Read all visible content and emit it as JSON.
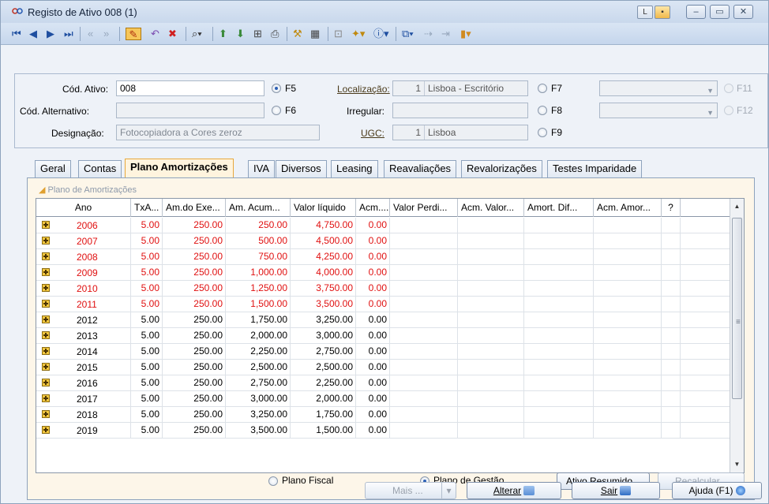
{
  "window": {
    "title": "Registo de Ativo 008 (1)"
  },
  "toolbar": {
    "icons": [
      "first-record-icon",
      "previous-record-icon",
      "next-record-icon",
      "last-record-icon",
      "page-back-icon",
      "page-forward-icon",
      "edit-icon",
      "undo-icon",
      "delete-icon",
      "search-icon",
      "import-icon",
      "export-icon",
      "tree-icon",
      "print-icon",
      "tools-icon",
      "calculator-icon",
      "zoom-icon",
      "paint-icon",
      "info-icon",
      "copy-icon",
      "link-icon",
      "unlink-icon",
      "bookmark-icon"
    ]
  },
  "header": {
    "cod_ativo_label": "Cód. Ativo:",
    "cod_ativo_value": "008",
    "cod_alt_label": "Cód. Alternativo:",
    "cod_alt_value": "",
    "designacao_label": "Designação:",
    "designacao_value": "Fotocopiadora a Cores zeroz",
    "localizacao_label": "Localização:",
    "localizacao_num": "1",
    "localizacao_value": "Lisboa - Escritório",
    "irregular_label": "Irregular:",
    "ugc_label": "UGC:",
    "ugc_num": "1",
    "ugc_value": "Lisboa",
    "radios": {
      "f5": "F5",
      "f6": "F6",
      "f7": "F7",
      "f8": "F8",
      "f9": "F9",
      "f11": "F11",
      "f12": "F12"
    }
  },
  "tabs": [
    "Geral",
    "Contas",
    "Plano Amortizações",
    "IVA",
    "Diversos",
    "Leasing",
    "Reavaliações",
    "Revalorizações",
    "Testes Imparidade"
  ],
  "grid": {
    "group_label": "Plano de Amortizações",
    "columns": [
      "Ano",
      "TxA...",
      "Am.do Exe...",
      "Am. Acum...",
      "Valor líquido",
      "Acm....",
      "Valor Perdi...",
      "Acm. Valor...",
      "Amort. Dif...",
      "Acm. Amor...",
      "?"
    ],
    "rows": [
      {
        "ano": "2006",
        "tx": "5.00",
        "am": "250.00",
        "acum": "250.00",
        "vl": "4,750.00",
        "acm": "0.00",
        "red": true
      },
      {
        "ano": "2007",
        "tx": "5.00",
        "am": "250.00",
        "acum": "500.00",
        "vl": "4,500.00",
        "acm": "0.00",
        "red": true
      },
      {
        "ano": "2008",
        "tx": "5.00",
        "am": "250.00",
        "acum": "750.00",
        "vl": "4,250.00",
        "acm": "0.00",
        "red": true
      },
      {
        "ano": "2009",
        "tx": "5.00",
        "am": "250.00",
        "acum": "1,000.00",
        "vl": "4,000.00",
        "acm": "0.00",
        "red": true
      },
      {
        "ano": "2010",
        "tx": "5.00",
        "am": "250.00",
        "acum": "1,250.00",
        "vl": "3,750.00",
        "acm": "0.00",
        "red": true
      },
      {
        "ano": "2011",
        "tx": "5.00",
        "am": "250.00",
        "acum": "1,500.00",
        "vl": "3,500.00",
        "acm": "0.00",
        "red": true
      },
      {
        "ano": "2012",
        "tx": "5.00",
        "am": "250.00",
        "acum": "1,750.00",
        "vl": "3,250.00",
        "acm": "0.00",
        "red": false
      },
      {
        "ano": "2013",
        "tx": "5.00",
        "am": "250.00",
        "acum": "2,000.00",
        "vl": "3,000.00",
        "acm": "0.00",
        "red": false
      },
      {
        "ano": "2014",
        "tx": "5.00",
        "am": "250.00",
        "acum": "2,250.00",
        "vl": "2,750.00",
        "acm": "0.00",
        "red": false
      },
      {
        "ano": "2015",
        "tx": "5.00",
        "am": "250.00",
        "acum": "2,500.00",
        "vl": "2,500.00",
        "acm": "0.00",
        "red": false
      },
      {
        "ano": "2016",
        "tx": "5.00",
        "am": "250.00",
        "acum": "2,750.00",
        "vl": "2,250.00",
        "acm": "0.00",
        "red": false
      },
      {
        "ano": "2017",
        "tx": "5.00",
        "am": "250.00",
        "acum": "3,000.00",
        "vl": "2,000.00",
        "acm": "0.00",
        "red": false
      },
      {
        "ano": "2018",
        "tx": "5.00",
        "am": "250.00",
        "acum": "3,250.00",
        "vl": "1,750.00",
        "acm": "0.00",
        "red": false
      },
      {
        "ano": "2019",
        "tx": "5.00",
        "am": "250.00",
        "acum": "3,500.00",
        "vl": "1,500.00",
        "acm": "0.00",
        "red": false
      }
    ]
  },
  "plan": {
    "fiscal_label": "Plano Fiscal",
    "gestao_label": "Plano de Gestão",
    "ativo_resumido": "Ativo Resumido...",
    "recalcular": "Recalcular..."
  },
  "footer": {
    "mais": "Mais ...",
    "alterar": "Alterar",
    "sair": "Sair",
    "ajuda": "Ajuda (F1)"
  },
  "colors": {
    "red_row": "#e01010",
    "active_tab": "#fff4de"
  }
}
